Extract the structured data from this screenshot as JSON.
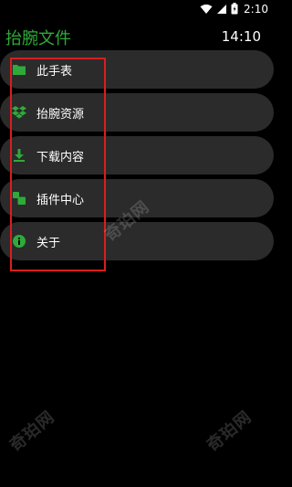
{
  "status_bar": {
    "time": "2:10",
    "icons": [
      "wifi-icon",
      "signal-icon",
      "battery-icon"
    ]
  },
  "header": {
    "app_title": "抬腕文件",
    "clock": "14:10"
  },
  "menu": {
    "items": [
      {
        "label": "此手表",
        "icon": "folder-icon"
      },
      {
        "label": "抬腕资源",
        "icon": "dropbox-icon"
      },
      {
        "label": "下载内容",
        "icon": "download-icon"
      },
      {
        "label": "插件中心",
        "icon": "plugin-icon"
      },
      {
        "label": "关于",
        "icon": "info-icon"
      }
    ]
  },
  "watermark": {
    "text": "奇珀网"
  },
  "colors": {
    "accent": "#2faa3a",
    "item_background": "#2b2b2b",
    "highlight": "#d81e1e"
  }
}
